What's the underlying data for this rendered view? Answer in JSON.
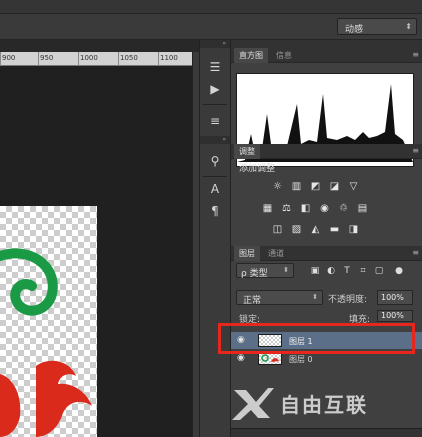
{
  "options_bar": {
    "workspace": "动感"
  },
  "ruler": {
    "ticks": [
      "900",
      "950",
      "1000",
      "1050",
      "1100"
    ]
  },
  "tool_strip": {
    "icons": [
      "sliders-icon",
      "play-icon",
      "brush-settings-icon",
      "clone-source-icon",
      "character-icon",
      "paragraph-icon"
    ]
  },
  "histogram": {
    "tabs": [
      {
        "label": "直方图"
      },
      {
        "label": "信息"
      }
    ]
  },
  "adjustments": {
    "tab": "调整",
    "title": "添加调整",
    "row1": [
      "brightness-icon",
      "levels-icon",
      "curves-icon",
      "exposure-icon",
      "vibrance-icon"
    ],
    "row2": [
      "hue-saturation-icon",
      "color-balance-icon",
      "black-white-icon",
      "photo-filter-icon",
      "channel-mixer-icon",
      "color-lookup-icon"
    ],
    "row3": [
      "invert-icon",
      "posterize-icon",
      "threshold-icon",
      "gradient-map-icon",
      "selective-color-icon"
    ]
  },
  "layers_panel": {
    "tabs": [
      {
        "label": "图层"
      },
      {
        "label": "通道"
      }
    ],
    "kind": "ρ 类型",
    "blend_mode": "正常",
    "opacity_label": "不透明度:",
    "opacity": "100%",
    "lock_label": "锁定:",
    "fill_label": "填充:",
    "fill": "100%",
    "layers": [
      {
        "name": "图层 1",
        "selected": true
      },
      {
        "name": "图层 0",
        "selected": false
      }
    ]
  },
  "watermark": {
    "text": "自由互联"
  },
  "colors": {
    "highlight": "#e7261d",
    "logo_green": "#1a9a44",
    "logo_red": "#d92a1c",
    "selection": "#5b7088"
  }
}
